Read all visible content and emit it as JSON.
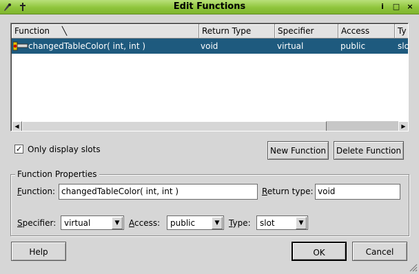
{
  "window": {
    "title": "Edit Functions",
    "title_buttons": [
      "i",
      "□",
      "×"
    ]
  },
  "list": {
    "columns": [
      "Function",
      "Return Type",
      "Specifier",
      "Access",
      "Ty"
    ],
    "sort_indicator": "╲",
    "rows": [
      {
        "function": "changedTableColor( int, int )",
        "return_type": "void",
        "specifier": "virtual",
        "access": "public",
        "type": "slot"
      }
    ]
  },
  "checkbox": {
    "label": "Only display slots",
    "checked": true,
    "mark": "✓"
  },
  "buttons": {
    "new_function": "New Function",
    "delete_function": "Delete Function",
    "help": "Help",
    "ok": "OK",
    "cancel": "Cancel"
  },
  "properties": {
    "title": "Function Properties",
    "function_label": "Function:",
    "function_value": "changedTableColor( int, int )",
    "return_type_label": "Return type:",
    "return_type_value": "void",
    "specifier_label": "Specifier:",
    "specifier_value": "virtual",
    "access_label": "Access:",
    "access_value": "public",
    "type_label": "Type:",
    "type_value": "slot"
  },
  "icons": {
    "arrow_down": "▼",
    "arrow_left": "◀",
    "arrow_right": "▶"
  },
  "colors": {
    "selection": "#1e5a7e",
    "titlebar": "#8fc53c"
  }
}
